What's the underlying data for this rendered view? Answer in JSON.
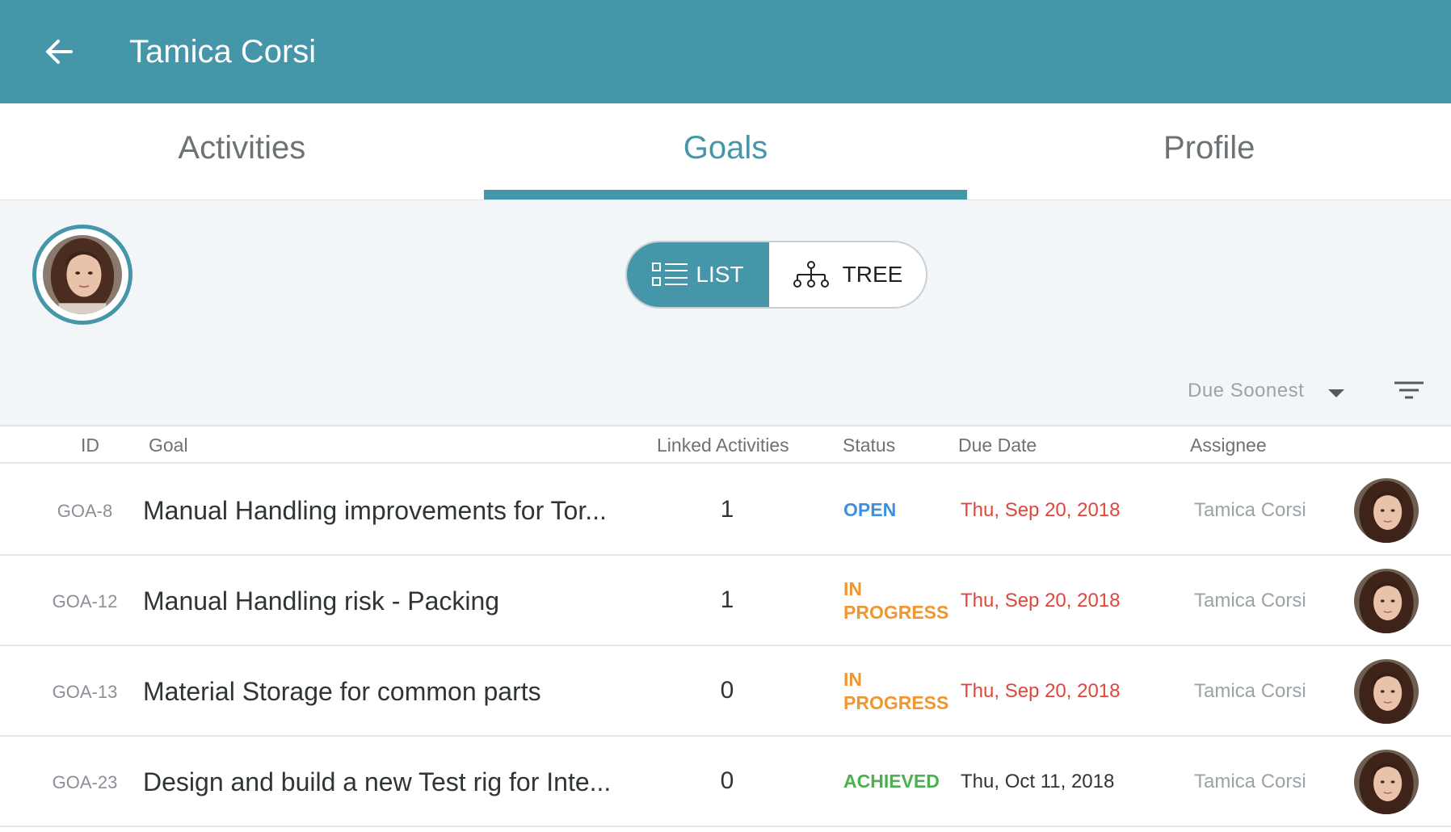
{
  "app_bar": {
    "title": "Tamica Corsi",
    "color": "#4596a8"
  },
  "tabs": [
    {
      "label": "Activities",
      "active": false
    },
    {
      "label": "Goals",
      "active": true
    },
    {
      "label": "Profile",
      "active": false
    }
  ],
  "view_toggle": {
    "list_label": "LIST",
    "tree_label": "TREE",
    "selected": "LIST"
  },
  "sort": {
    "label": "Due Soonest"
  },
  "table": {
    "headers": {
      "id": "ID",
      "goal": "Goal",
      "linked": "Linked Activities",
      "status": "Status",
      "due": "Due Date",
      "assignee": "Assignee"
    },
    "rows": [
      {
        "id": "GOA-8",
        "goal": "Manual Handling improvements for Tor...",
        "linked": "1",
        "status_line1": "OPEN",
        "status_line2": "",
        "status_color": "#3d8fe0",
        "due": "Thu, Sep 20, 2018",
        "due_color": "#e0463a",
        "assignee": "Tamica Corsi"
      },
      {
        "id": "GOA-12",
        "goal": "Manual Handling risk - Packing",
        "linked": "1",
        "status_line1": "IN",
        "status_line2": "PROGRESS",
        "status_color": "#f0962d",
        "due": "Thu, Sep 20, 2018",
        "due_color": "#e0463a",
        "assignee": "Tamica Corsi"
      },
      {
        "id": "GOA-13",
        "goal": "Material Storage for common parts",
        "linked": "0",
        "status_line1": "IN",
        "status_line2": "PROGRESS",
        "status_color": "#f0962d",
        "due": "Thu, Sep 20, 2018",
        "due_color": "#e0463a",
        "assignee": "Tamica Corsi"
      },
      {
        "id": "GOA-23",
        "goal": "Design and build a new Test rig for Inte...",
        "linked": "0",
        "status_line1": "ACHIEVED",
        "status_line2": "",
        "status_color": "#4caf50",
        "due": "Thu, Oct 11, 2018",
        "due_color": "#2f3437",
        "assignee": "Tamica Corsi"
      }
    ]
  },
  "icons": {
    "back": "arrow-left-icon",
    "list": "list-icon",
    "tree": "tree-icon",
    "sort": "caret-down-icon",
    "filter": "filter-icon",
    "avatar": "user-avatar"
  }
}
